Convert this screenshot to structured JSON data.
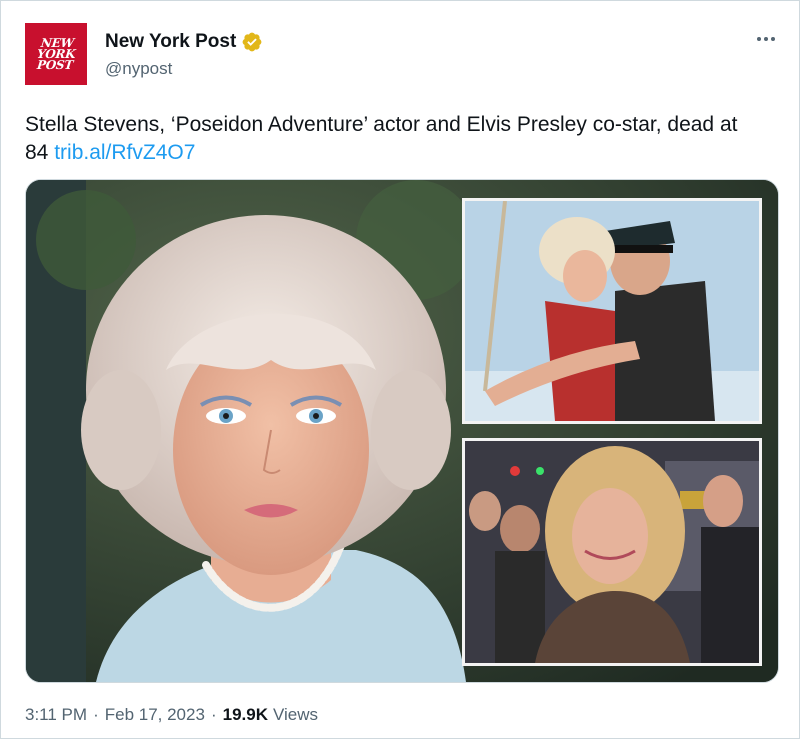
{
  "author": {
    "display_name": "New York Post",
    "handle": "@nypost",
    "avatar_logo": [
      "NEW",
      "YORK",
      "POST"
    ],
    "verified_icon": "verified-badge-icon",
    "verified_color": "#e2b719",
    "brand_color": "#c8102e"
  },
  "menu": {
    "icon": "more-options-icon"
  },
  "tweet": {
    "text": "Stella Stevens, ‘Poseidon Adventure’ actor and Elvis Presley co-star, dead at 84",
    "link": "trib.al/RfvZ4O7",
    "link_color": "#1d9bf0"
  },
  "footer": {
    "time": "3:11 PM",
    "separator": "·",
    "date": "Feb 17, 2023",
    "views_count": "19.9K",
    "views_label": "Views"
  }
}
